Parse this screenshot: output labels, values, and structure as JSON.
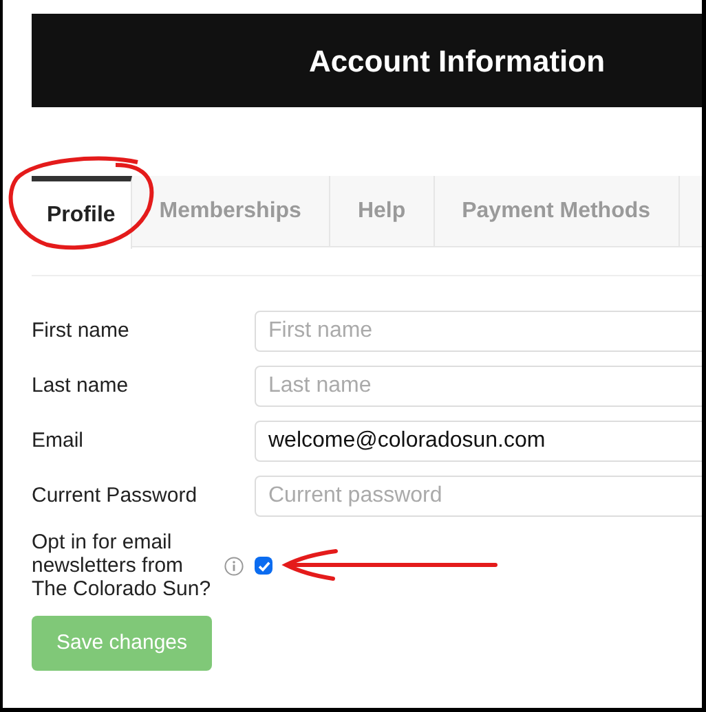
{
  "header": {
    "title": "Account Information"
  },
  "tabs": [
    {
      "label": "Profile",
      "selected": true
    },
    {
      "label": "Memberships",
      "selected": false
    },
    {
      "label": "Help",
      "selected": false
    },
    {
      "label": "Payment Methods",
      "selected": false
    }
  ],
  "form": {
    "fields": [
      {
        "label": "First name",
        "placeholder": "First name"
      },
      {
        "label": "Last name",
        "placeholder": "Last name"
      },
      {
        "label": "Email",
        "value": "welcome@coloradosun.com"
      },
      {
        "label": "Current Password",
        "placeholder": "Current password"
      }
    ],
    "newsletter": {
      "label": "Opt in for email newsletters from The Colorado Sun?",
      "checked": true
    },
    "save_button": "Save changes"
  }
}
